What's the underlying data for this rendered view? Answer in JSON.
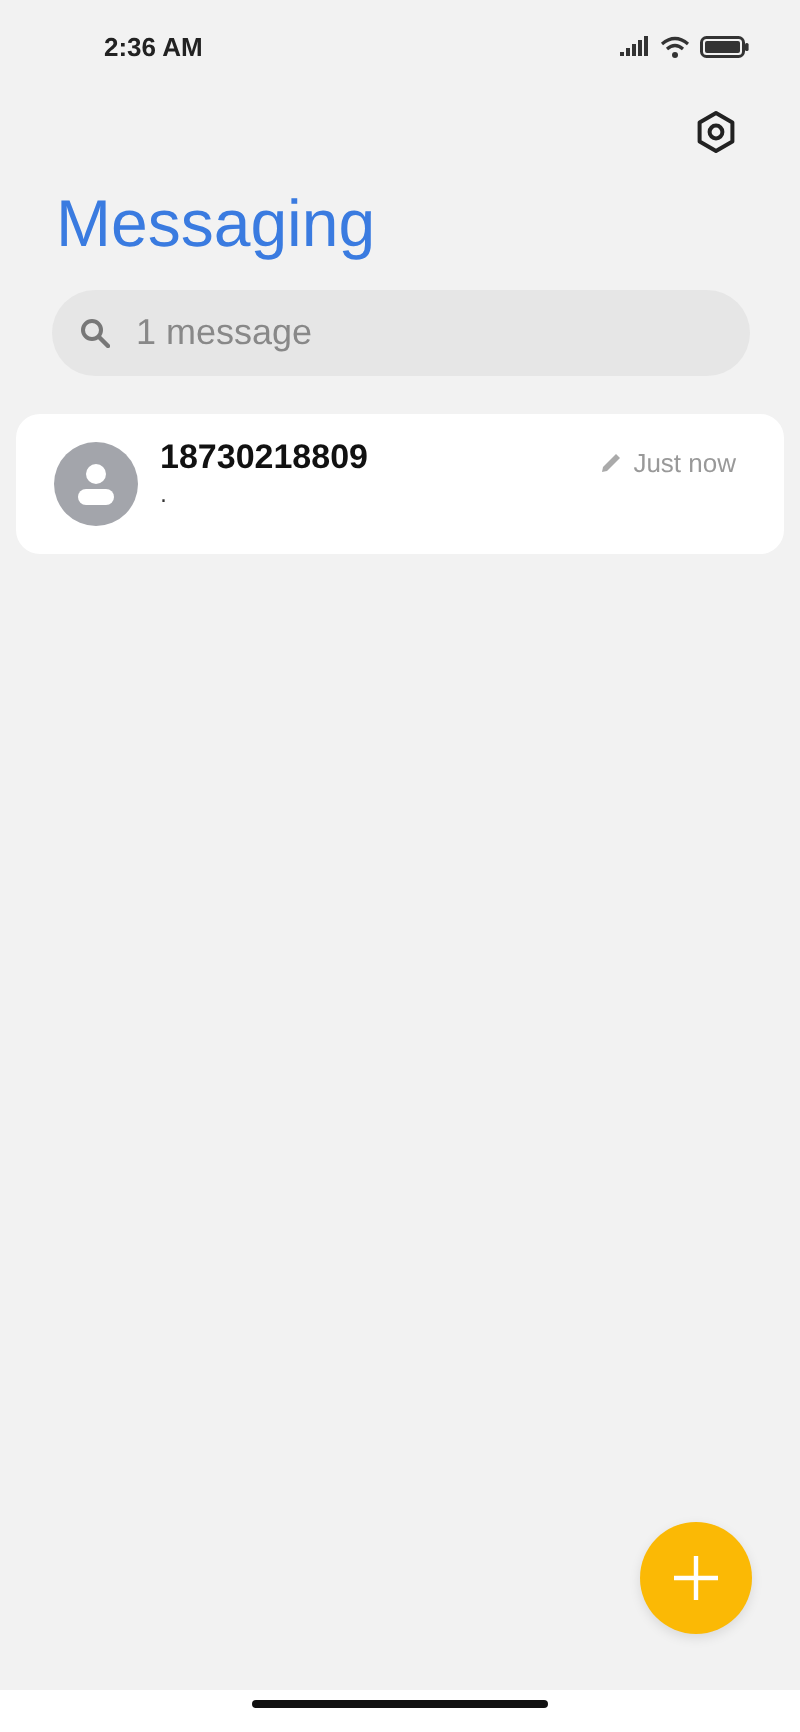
{
  "status_bar": {
    "time": "2:36 AM"
  },
  "title": "Messaging",
  "search": {
    "placeholder": "1 message"
  },
  "conversations": [
    {
      "sender": "18730218809",
      "preview": ".",
      "time": "Just now",
      "draft": true
    }
  ]
}
